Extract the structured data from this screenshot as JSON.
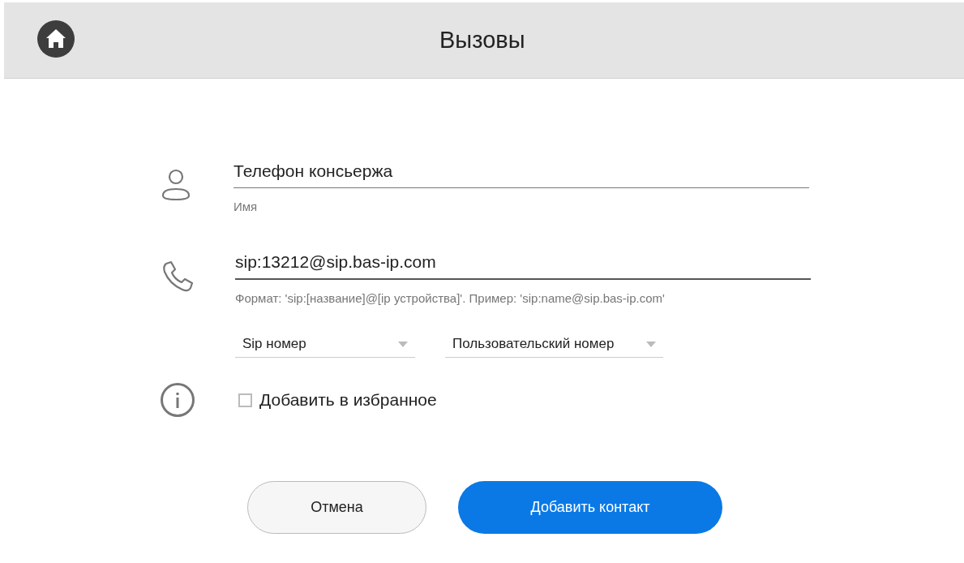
{
  "header": {
    "title": "Вызовы"
  },
  "name_field": {
    "value": "Телефон консьержа",
    "label": "Имя"
  },
  "number_field": {
    "value": "sip:13212@sip.bas-ip.com",
    "hint": "Формат: 'sip:[название]@[ip устройства]'. Пример: 'sip:name@sip.bas-ip.com'"
  },
  "dropdowns": [
    {
      "value": "Sip номер"
    },
    {
      "value": "Пользовательский номер"
    }
  ],
  "favorite": {
    "label": "Добавить в избранное",
    "checked": false
  },
  "buttons": [
    {
      "label": "Отмена",
      "kind": "secondary"
    },
    {
      "label": "Добавить контакт",
      "kind": "primary"
    }
  ]
}
